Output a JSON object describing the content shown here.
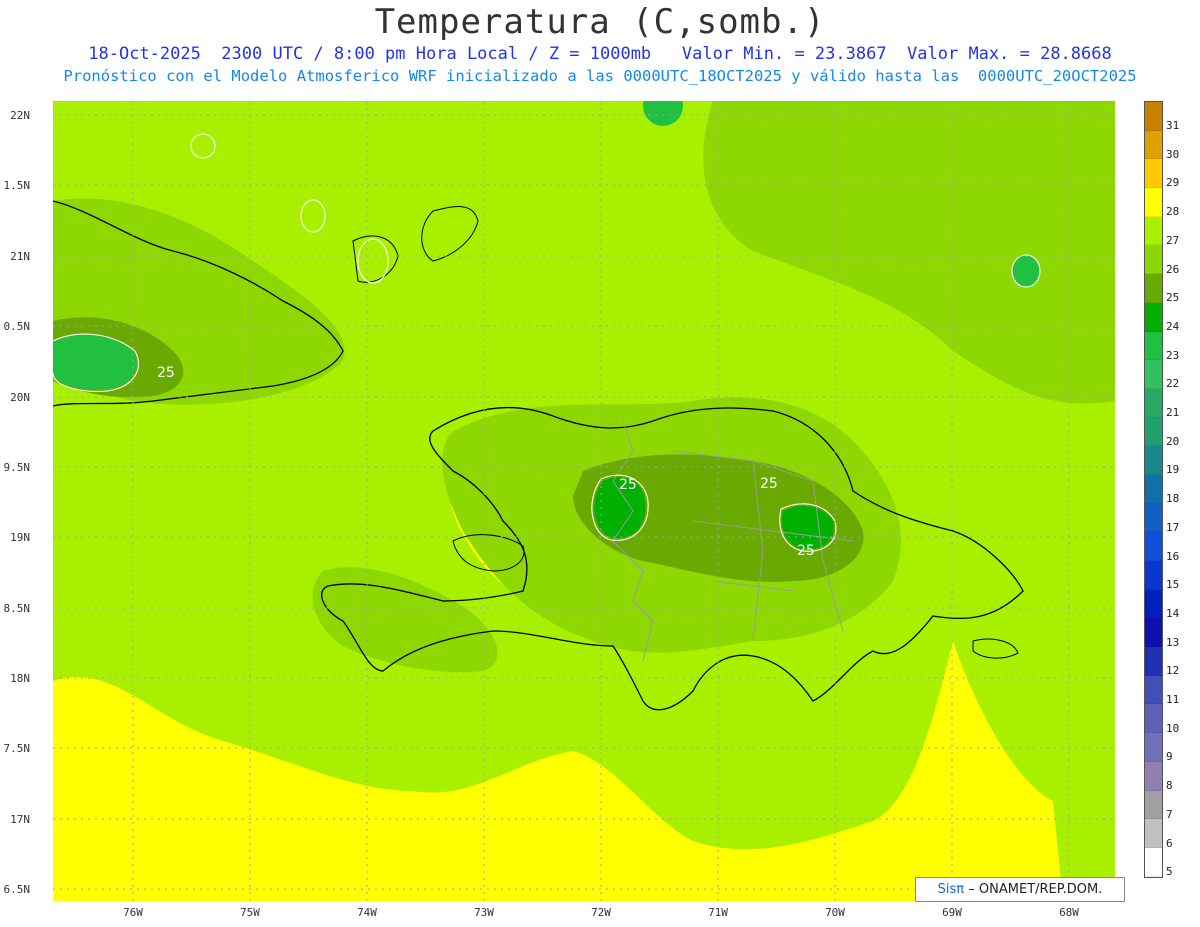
{
  "header": {
    "title": "Temperatura (C,somb.)",
    "line1": "18-Oct-2025  2300 UTC / 8:00 pm Hora Local / Z = 1000mb   Valor Min. = 23.3867  Valor Max. = 28.8668",
    "line2": "Pronóstico con el Modelo Atmosferico WRF inicializado a las 0000UTC_18OCT2025 y válido hasta las  0000UTC_20OCT2025"
  },
  "axes": {
    "lat_labels": [
      "22N",
      "1.5N",
      "21N",
      "0.5N",
      "20N",
      "9.5N",
      "19N",
      "8.5N",
      "18N",
      "7.5N",
      "17N",
      "6.5N"
    ],
    "lon_labels": [
      "76W",
      "75W",
      "74W",
      "73W",
      "72W",
      "71W",
      "70W",
      "69W",
      "68W"
    ]
  },
  "legend": {
    "labels": [
      "31",
      "30",
      "29",
      "28",
      "27",
      "26",
      "25",
      "24",
      "23",
      "22",
      "21",
      "20",
      "19",
      "18",
      "17",
      "16",
      "15",
      "14",
      "13",
      "12",
      "11",
      "10",
      "9",
      "8",
      "7",
      "6",
      "5"
    ],
    "colors": [
      "#c88000",
      "#e0a000",
      "#ffc800",
      "#ffff00",
      "#a8f000",
      "#8cd800",
      "#6aaa00",
      "#00b000",
      "#22c040",
      "#33c060",
      "#28a860",
      "#20a070",
      "#1a8888",
      "#1070a8",
      "#1060c8",
      "#1050d8",
      "#0838d0",
      "#0020c0",
      "#1010b0",
      "#2030b0",
      "#4050b8",
      "#6060b8",
      "#7070b8",
      "#9080b0",
      "#a0a0a0",
      "#c0c0c0",
      "#ffffff"
    ]
  },
  "contour_labels": [
    "25",
    "25",
    "25",
    "25"
  ],
  "credit": {
    "sis": "Sisπ",
    "rest": "– ONAMET/REP.DOM."
  }
}
